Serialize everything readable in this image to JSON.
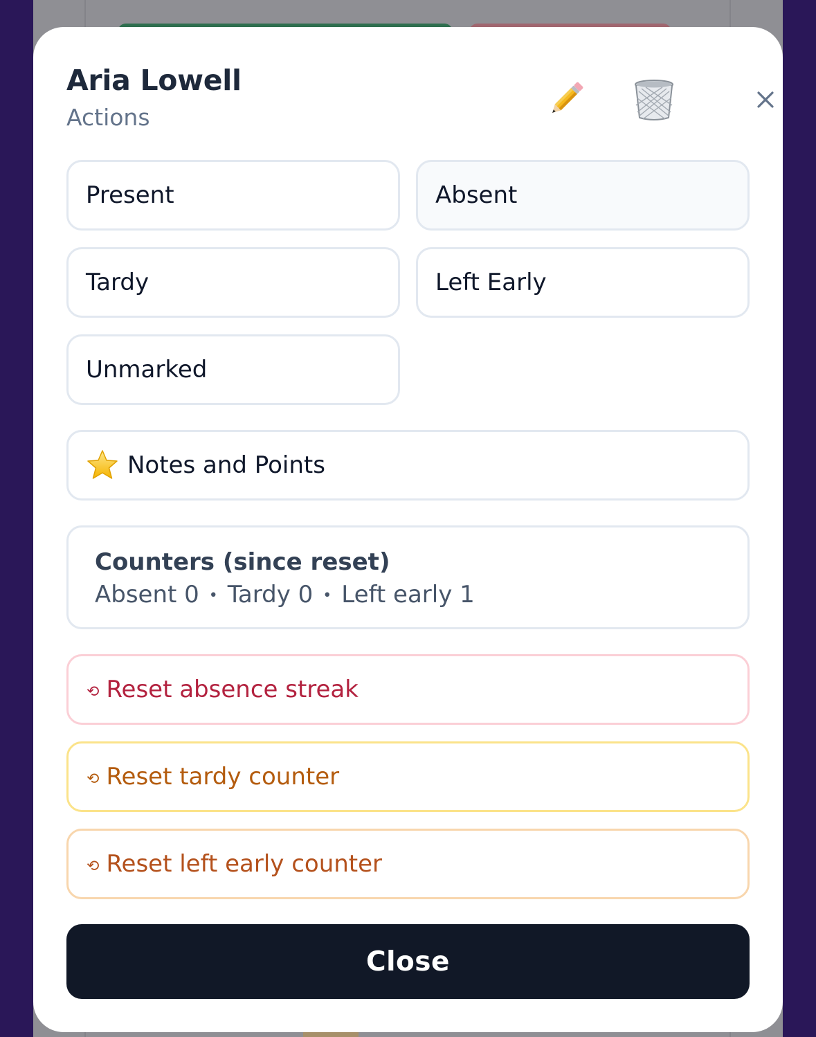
{
  "modal": {
    "student_name": "Aria Lowell",
    "subtitle": "Actions",
    "header_icons": [
      "pencil-icon",
      "trash-icon",
      "close-icon"
    ]
  },
  "status_options": [
    {
      "label": "Present",
      "selected": false
    },
    {
      "label": "Absent",
      "selected": true
    },
    {
      "label": "Tardy",
      "selected": false
    },
    {
      "label": "Left Early",
      "selected": false
    },
    {
      "label": "Unmarked",
      "selected": false
    }
  ],
  "notes_button": {
    "icon": "star-icon",
    "label": "Notes and Points"
  },
  "counters": {
    "title": "Counters (since reset)",
    "absent": "Absent 0",
    "tardy": "Tardy 0",
    "left_early": "Left early 1",
    "separator": "•"
  },
  "reset_actions": [
    {
      "icon": "reset-icon",
      "glyph": "⟲",
      "label": "Reset absence streak",
      "color": "#b3223f"
    },
    {
      "icon": "reset-icon",
      "glyph": "⟲",
      "label": "Reset tardy counter",
      "color": "#b45c0e"
    },
    {
      "icon": "reset-icon",
      "glyph": "⟲",
      "label": "Reset left early counter",
      "color": "#b4511c"
    }
  ],
  "footer": {
    "close_label": "Close",
    "close_bg": "#111827"
  }
}
